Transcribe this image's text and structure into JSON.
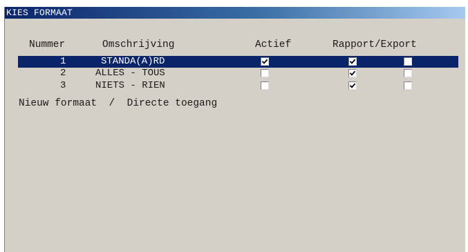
{
  "window": {
    "title": "KIES FORMAAT"
  },
  "columns": {
    "nummer": "Nummer",
    "omschrijving": "Omschrijving",
    "actief": "Actief",
    "rapport_export": "Rapport/Export"
  },
  "rows": [
    {
      "nummer": "1",
      "omschrijving": "STANDA(A)RD",
      "actief": true,
      "rapport": true,
      "export": false,
      "selected": true
    },
    {
      "nummer": "2",
      "omschrijving": "ALLES - TOUS",
      "actief": false,
      "rapport": true,
      "export": false,
      "selected": false
    },
    {
      "nummer": "3",
      "omschrijving": "NIETS - RIEN",
      "actief": false,
      "rapport": true,
      "export": false,
      "selected": false
    }
  ],
  "footer": {
    "text": "Nieuw formaat  /  Directe toegang"
  },
  "colors": {
    "selection": "#0a246a",
    "background": "#d4d0c8",
    "titlebar_start": "#0a246a",
    "titlebar_end": "#a6caf0"
  }
}
